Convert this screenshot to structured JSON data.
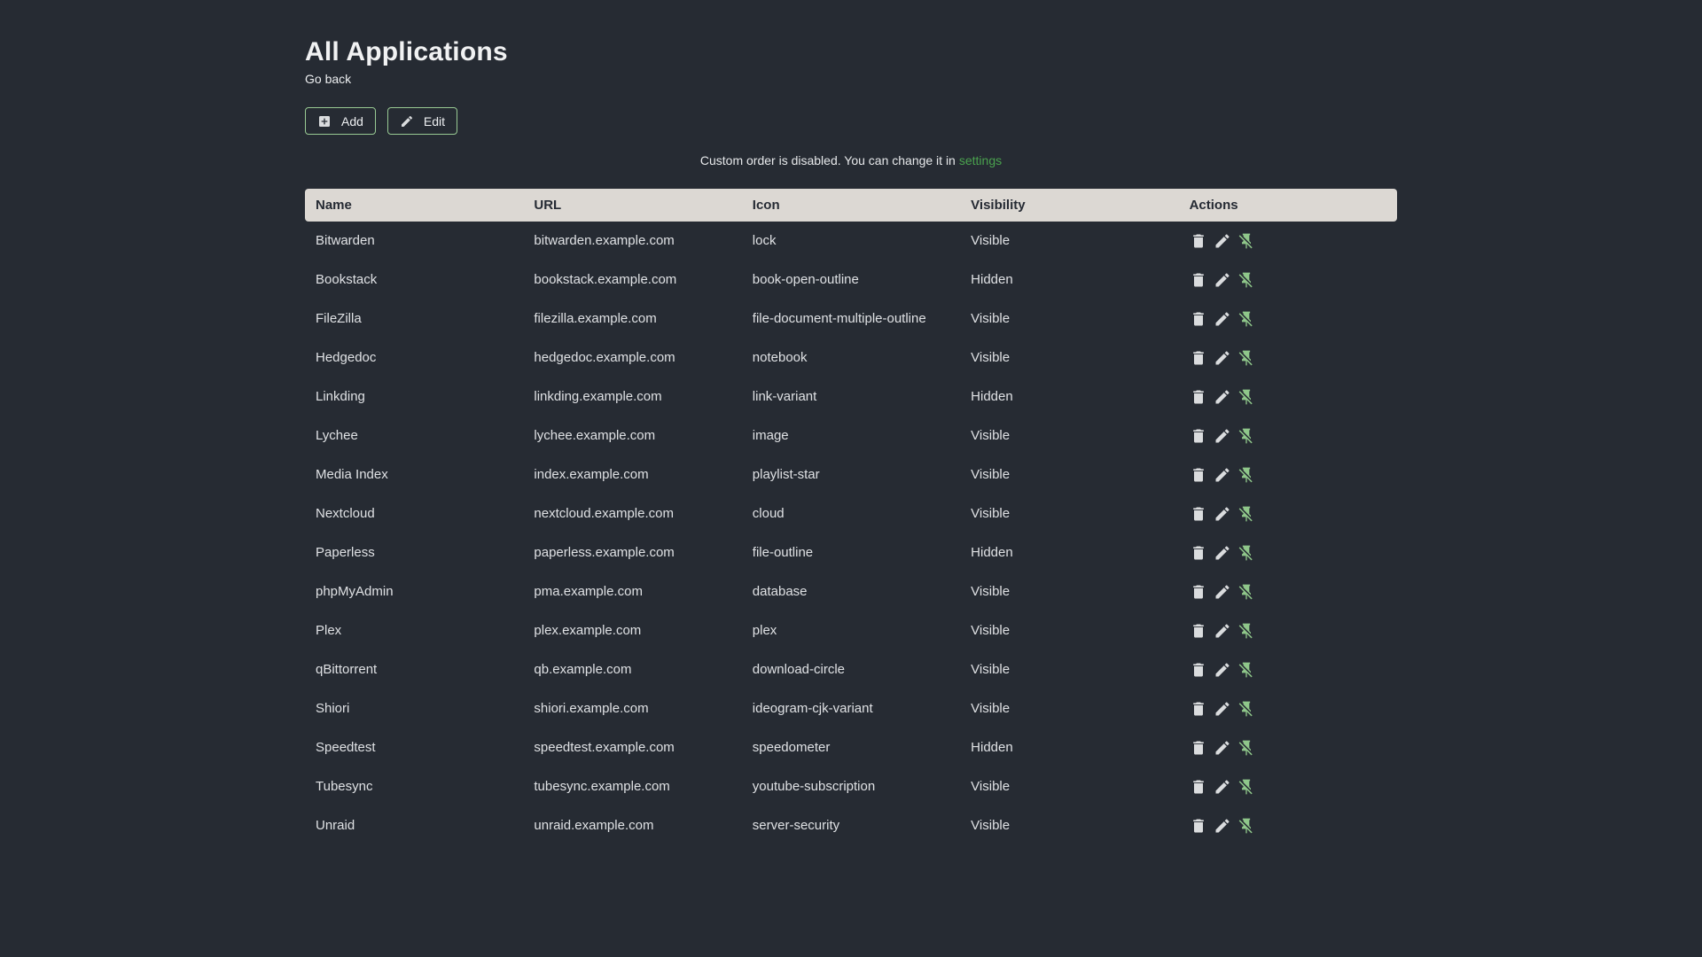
{
  "page": {
    "title": "All Applications",
    "back_link": "Go back",
    "notice": {
      "text": "Custom order is disabled. You can change it in",
      "link": "settings"
    }
  },
  "toolbar": {
    "add_label": "Add",
    "edit_label": "Edit"
  },
  "table": {
    "columns": [
      "Name",
      "URL",
      "Icon",
      "Visibility",
      "Actions"
    ],
    "row_actions": [
      "delete",
      "edit",
      "pin-off"
    ],
    "rows": [
      {
        "name": "Bitwarden",
        "url": "bitwarden.example.com",
        "icon": "lock",
        "visibility": "Visible"
      },
      {
        "name": "Bookstack",
        "url": "bookstack.example.com",
        "icon": "book-open-outline",
        "visibility": "Hidden"
      },
      {
        "name": "FileZilla",
        "url": "filezilla.example.com",
        "icon": "file-document-multiple-outline",
        "visibility": "Visible"
      },
      {
        "name": "Hedgedoc",
        "url": "hedgedoc.example.com",
        "icon": "notebook",
        "visibility": "Visible"
      },
      {
        "name": "Linkding",
        "url": "linkding.example.com",
        "icon": "link-variant",
        "visibility": "Hidden"
      },
      {
        "name": "Lychee",
        "url": "lychee.example.com",
        "icon": "image",
        "visibility": "Visible"
      },
      {
        "name": "Media Index",
        "url": "index.example.com",
        "icon": "playlist-star",
        "visibility": "Visible"
      },
      {
        "name": "Nextcloud",
        "url": "nextcloud.example.com",
        "icon": "cloud",
        "visibility": "Visible"
      },
      {
        "name": "Paperless",
        "url": "paperless.example.com",
        "icon": "file-outline",
        "visibility": "Hidden"
      },
      {
        "name": "phpMyAdmin",
        "url": "pma.example.com",
        "icon": "database",
        "visibility": "Visible"
      },
      {
        "name": "Plex",
        "url": "plex.example.com",
        "icon": "plex",
        "visibility": "Visible"
      },
      {
        "name": "qBittorrent",
        "url": "qb.example.com",
        "icon": "download-circle",
        "visibility": "Visible"
      },
      {
        "name": "Shiori",
        "url": "shiori.example.com",
        "icon": "ideogram-cjk-variant",
        "visibility": "Visible"
      },
      {
        "name": "Speedtest",
        "url": "speedtest.example.com",
        "icon": "speedometer",
        "visibility": "Hidden"
      },
      {
        "name": "Tubesync",
        "url": "tubesync.example.com",
        "icon": "youtube-subscription",
        "visibility": "Visible"
      },
      {
        "name": "Unraid",
        "url": "unraid.example.com",
        "icon": "server-security",
        "visibility": "Visible"
      }
    ]
  },
  "colors": {
    "background": "#262b33",
    "header_bg": "#dcd8d3",
    "header_text": "#252a33",
    "body_text": "#dfe1e4",
    "button_border_green": "#98c993",
    "settings_link_green": "#4aa24e",
    "pin_icon_green": "#8fc78a"
  }
}
